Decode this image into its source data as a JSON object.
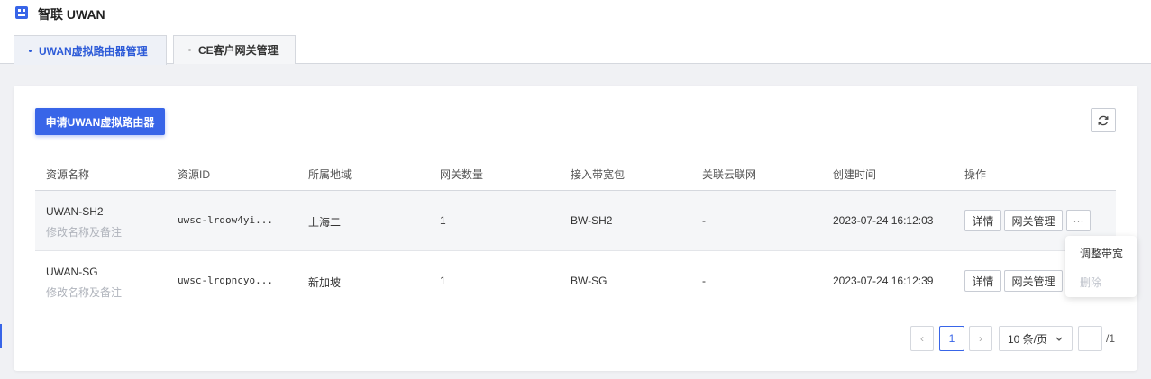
{
  "app": {
    "title": "智联 UWAN",
    "icon": "network-grid-icon"
  },
  "tabs": [
    {
      "label": "UWAN虚拟路由器管理",
      "active": true
    },
    {
      "label": "CE客户网关管理",
      "active": false
    }
  ],
  "toolbar": {
    "create_label": "申请UWAN虚拟路由器",
    "refresh_icon": "refresh-icon"
  },
  "table": {
    "headers": [
      "资源名称",
      "资源ID",
      "所属地域",
      "网关数量",
      "接入带宽包",
      "关联云联网",
      "创建时间",
      "操作"
    ],
    "rows": [
      {
        "name": "UWAN-SH2",
        "note": "修改名称及备注",
        "id": "uwsc-lrdow4yi...",
        "region": "上海二",
        "gateways": "1",
        "bandwidth": "BW-SH2",
        "ccn": "-",
        "created": "2023-07-24 16:12:03",
        "detail": "详情",
        "manage": "网关管理",
        "more": "···"
      },
      {
        "name": "UWAN-SG",
        "note": "修改名称及备注",
        "id": "uwsc-lrdpncyo...",
        "region": "新加坡",
        "gateways": "1",
        "bandwidth": "BW-SG",
        "ccn": "-",
        "created": "2023-07-24 16:12:39",
        "detail": "详情",
        "manage": "网关管理"
      }
    ]
  },
  "dropdown": {
    "items": [
      {
        "label": "调整带宽",
        "disabled": false
      },
      {
        "label": "删除",
        "disabled": true
      }
    ]
  },
  "pagination": {
    "prev": "‹",
    "current": "1",
    "next": "›",
    "page_size": "10 条/页",
    "jump_value": "",
    "total_pages": "/1"
  },
  "colors": {
    "primary": "#3865e8",
    "disabled_text": "#c0c4cc"
  }
}
